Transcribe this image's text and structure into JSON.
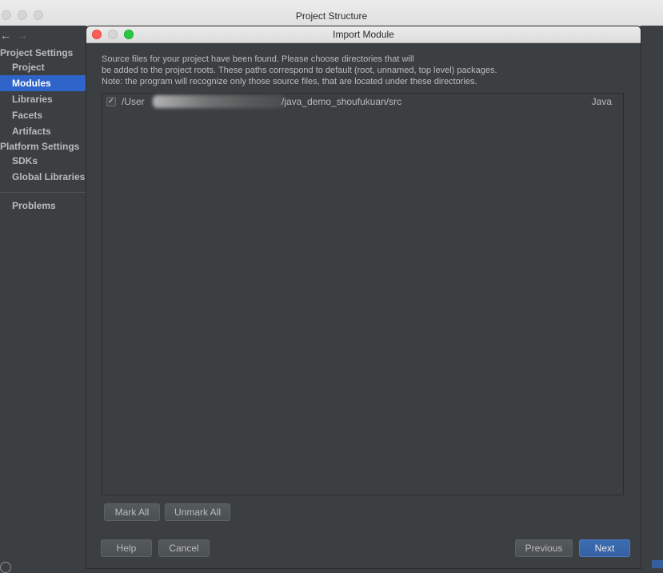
{
  "outer_window": {
    "title": "Project Structure"
  },
  "sidebar": {
    "sections": [
      {
        "label": "Project Settings",
        "items": [
          "Project",
          "Modules",
          "Libraries",
          "Facets",
          "Artifacts"
        ]
      },
      {
        "label": "Platform Settings",
        "items": [
          "SDKs",
          "Global Libraries"
        ]
      }
    ],
    "problems": "Problems",
    "selected": "Modules"
  },
  "dialog": {
    "title": "Import Module",
    "description": [
      "Source files for your project have been found. Please choose directories that will",
      "be added to the project roots. These paths correspond to default (root, unnamed, top level) packages.",
      "Note: the program will recognize only those source files, that are located under these directories."
    ],
    "roots": [
      {
        "checked": true,
        "path_start": "/User",
        "path_end": "/java_demo_shoufukuan/src",
        "language": "Java"
      }
    ],
    "buttons": {
      "mark_all": "Mark All",
      "unmark_all": "Unmark All",
      "help": "Help",
      "cancel": "Cancel",
      "previous": "Previous",
      "next": "Next"
    }
  },
  "colors": {
    "background": "#3c3f41",
    "selection": "#2f65ca",
    "primary_button": "#365fa0"
  }
}
